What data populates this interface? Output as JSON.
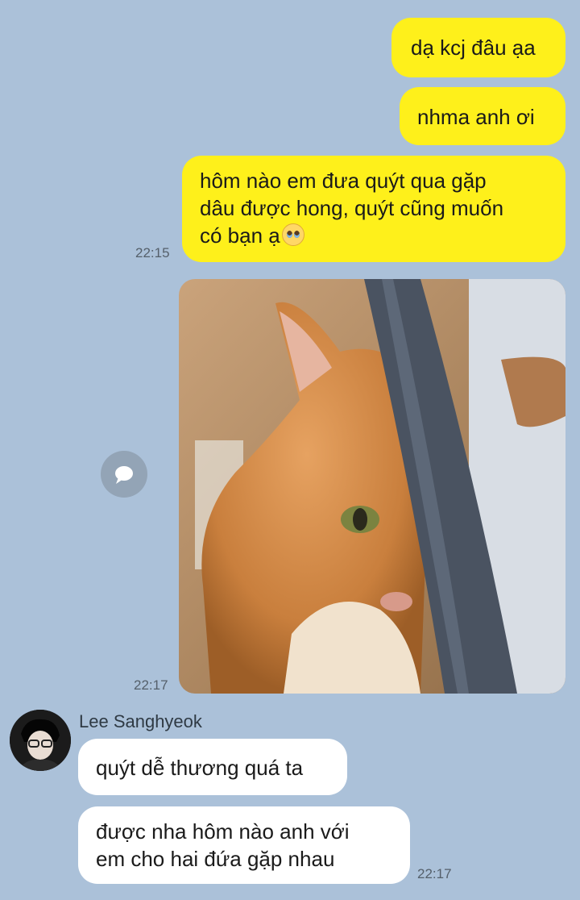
{
  "messages": {
    "m1": "dạ kcj đâu ạa",
    "m2": "nhma anh ơi",
    "m3_line1": "hôm nào em đưa quýt qua gặp",
    "m3_line2": "dâu được hong, quýt cũng muốn",
    "m3_line3": "có bạn ạ",
    "m3_emoji": "pleading-face-icon",
    "m3_time": "22:15",
    "photo_time": "22:17",
    "photo_content": "orange cat photo",
    "sender_name": "Lee Sanghyeok",
    "r1": "quýt dễ thương quá ta",
    "r2_line1": "được nha hôm nào anh với",
    "r2_line2": "em cho hai đứa gặp nhau",
    "r2_time": "22:17"
  },
  "colors": {
    "background": "#abc1d9",
    "outgoing_bubble": "#fef01b",
    "incoming_bubble": "#ffffff"
  },
  "icons": {
    "share": "chat-bubble-icon"
  }
}
